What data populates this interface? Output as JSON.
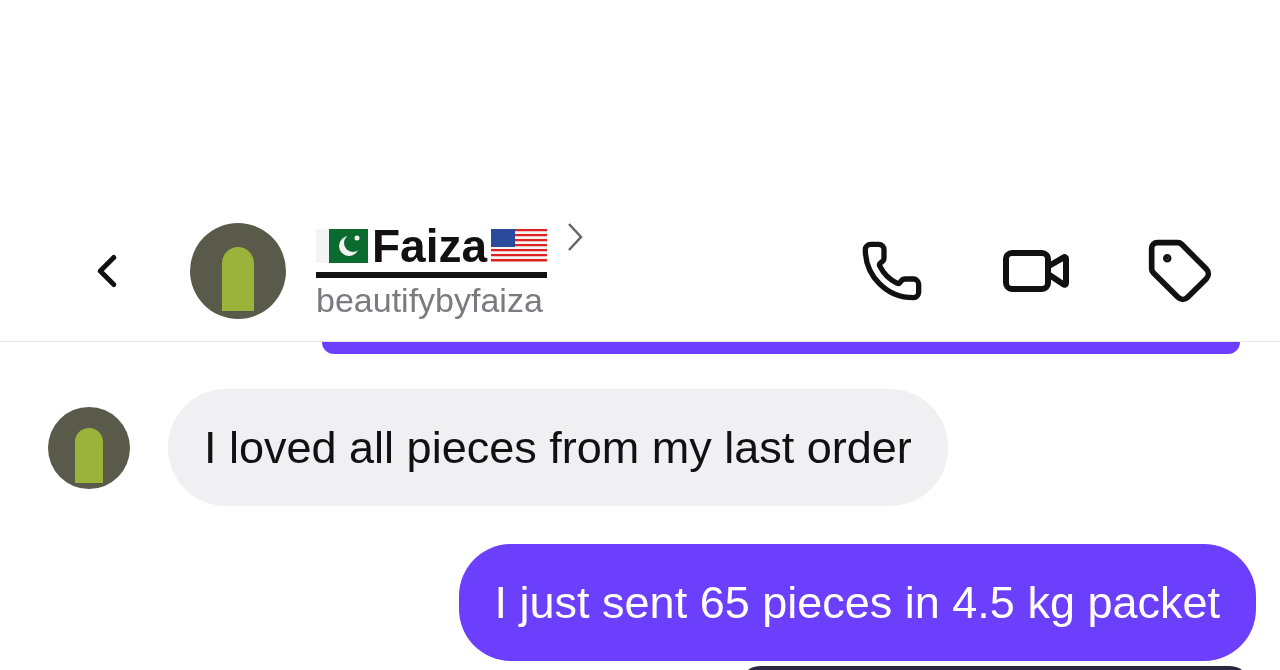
{
  "header": {
    "name": "Faiza",
    "username": "beautifybyfaiza"
  },
  "messages": [
    {
      "kind": "incoming",
      "text": "I loved all pieces from my last order"
    },
    {
      "kind": "outgoing",
      "text": "I just sent 65 pieces in 4.5 kg packet"
    }
  ]
}
